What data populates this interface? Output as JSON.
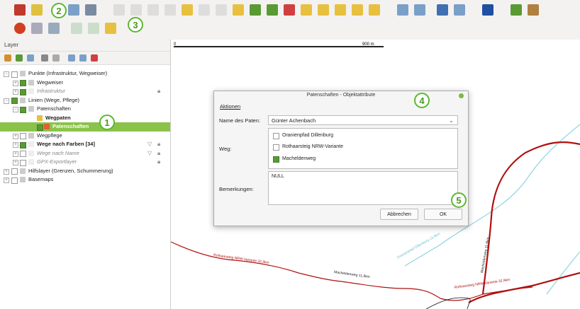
{
  "toolbar": {
    "badges": [
      "2",
      "3"
    ]
  },
  "layer_panel": {
    "title": "Layer",
    "items": [
      {
        "label": "Punkte (Infrastruktur, Wegweiser)"
      },
      {
        "label": "Wegweiser"
      },
      {
        "label": "Infrastruktur"
      },
      {
        "label": "Linien (Wege, Pflege)"
      },
      {
        "label": "Patenschaften"
      },
      {
        "label": "Wegpaten"
      },
      {
        "label": "Patenschaften"
      },
      {
        "label": "Wegpflege"
      },
      {
        "label": "Wege nach Farben [34]"
      },
      {
        "label": "Wege nach Name"
      },
      {
        "label": "GPX-Exportlayer"
      },
      {
        "label": "Hilfslayer (Grenzen, Schummerung)"
      },
      {
        "label": "Basemaps"
      }
    ],
    "badge": "1"
  },
  "map": {
    "scale_label": "0",
    "scale_right": "900 m",
    "road_labels": [
      "Rothaarsteig NRW-Variante 32,9km",
      "Macheldenweg 11,9km",
      "Rothaarsteig NRW-Variante 32,9km",
      "Macheldenweg 11,9km",
      "Oranienpfad Dillenburg 13,4km"
    ]
  },
  "dialog": {
    "title": "Patenschaften - Objektattribute",
    "menu": "Aktionen",
    "badge_top": "4",
    "badge_bottom": "5",
    "name_label": "Name des Paten:",
    "name_value": "Günter Achenbach",
    "weg_label": "Weg:",
    "weg_options": [
      {
        "label": "Oranienpfad Dillenburg",
        "checked": false
      },
      {
        "label": "Rothaarsteig NRW-Variante",
        "checked": false
      },
      {
        "label": "Macheldenweg",
        "checked": true
      }
    ],
    "remarks_label": "Bemerkungen:",
    "remarks_value": "NULL",
    "cancel": "Abbrechen",
    "ok": "OK"
  }
}
